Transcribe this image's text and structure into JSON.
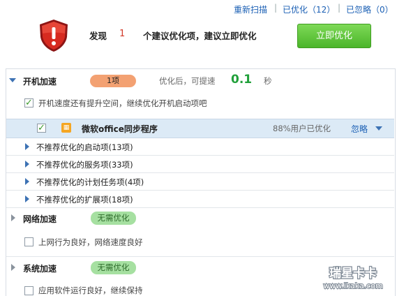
{
  "top_links": {
    "rescan": "重新扫描",
    "optimized": "已优化（12）",
    "ignored": "已忽略（0）",
    "sep": "|"
  },
  "summary": {
    "prefix": "发现",
    "count": "1",
    "suffix": "个建议优化项，建议立即优化",
    "button": "立即优化"
  },
  "startup": {
    "title": "开机加速",
    "badge": "1项",
    "speed_prefix": "优化后，可提速",
    "speed_value": "0.1",
    "speed_unit": "秒",
    "hint": "开机速度还有提升空间，继续优化开机启动项吧",
    "item": {
      "name": "微软office同步程序",
      "stat": "88%用户已优化",
      "ignore": "忽略"
    },
    "subsections": [
      "不推荐优化的启动项(13项)",
      "不推荐优化的服务项(33项)",
      "不推荐优化的计划任务项(4项)",
      "不推荐优化的扩展项(18项)"
    ]
  },
  "network": {
    "title": "网络加速",
    "badge": "无需优化",
    "hint": "上网行为良好，网络速度良好"
  },
  "system": {
    "title": "系统加速",
    "badge": "无需优化",
    "hint": "应用软件运行良好，继续保持"
  },
  "watermark": {
    "line1": "瑞星卡卡",
    "line2": "www.ikaka.com"
  },
  "colors": {
    "accent_green": "#4bb52a",
    "link_blue": "#1a5fb4",
    "alert_red": "#d23a2a"
  }
}
